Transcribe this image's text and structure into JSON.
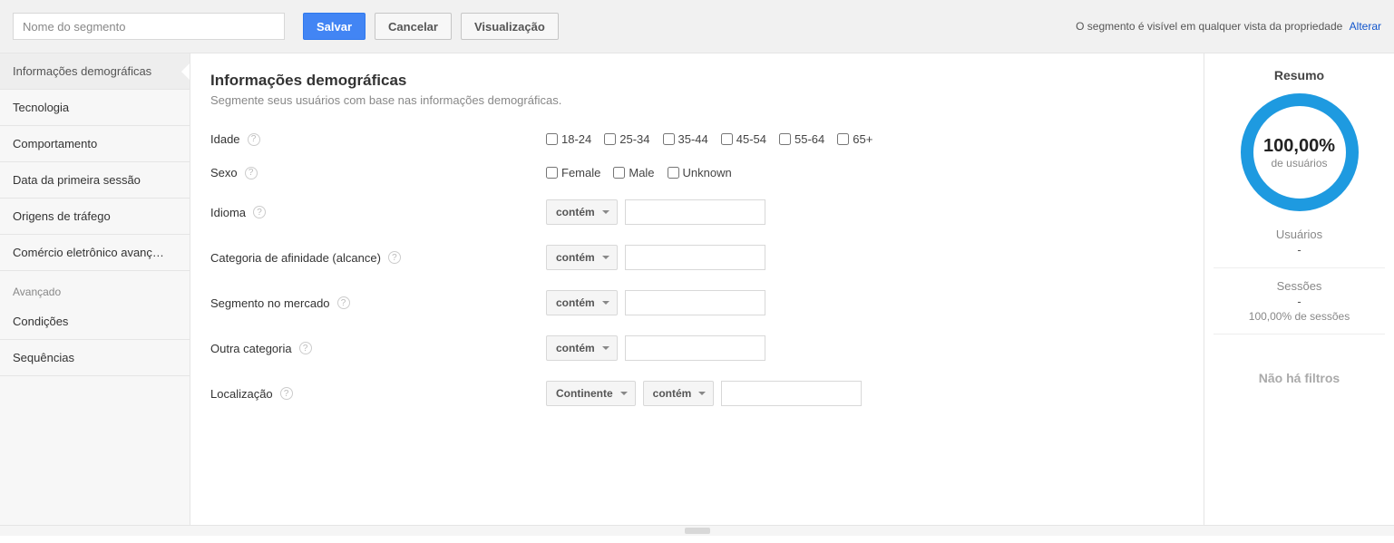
{
  "topbar": {
    "segment_placeholder": "Nome do segmento",
    "save_label": "Salvar",
    "cancel_label": "Cancelar",
    "preview_label": "Visualização",
    "visibility_text": "O segmento é visível em qualquer vista da propriedade",
    "change_link": "Alterar"
  },
  "sidebar": {
    "items": [
      {
        "label": "Informações demográficas",
        "active": true
      },
      {
        "label": "Tecnologia"
      },
      {
        "label": "Comportamento"
      },
      {
        "label": "Data da primeira sessão"
      },
      {
        "label": "Origens de tráfego"
      },
      {
        "label": "Comércio eletrônico avanç…"
      }
    ],
    "advanced_label": "Avançado",
    "advanced_items": [
      {
        "label": "Condições"
      },
      {
        "label": "Sequências"
      }
    ]
  },
  "main": {
    "title": "Informações demográficas",
    "subtitle": "Segmente seus usuários com base nas informações demográficas.",
    "age_label": "Idade",
    "age_options": [
      "18-24",
      "25-34",
      "35-44",
      "45-54",
      "55-64",
      "65+"
    ],
    "gender_label": "Sexo",
    "gender_options": [
      "Female",
      "Male",
      "Unknown"
    ],
    "language_label": "Idioma",
    "affinity_label": "Categoria de afinidade (alcance)",
    "market_label": "Segmento no mercado",
    "other_category_label": "Outra categoria",
    "location_label": "Localização",
    "contains_label": "contém",
    "continent_label": "Continente"
  },
  "summary": {
    "title": "Resumo",
    "donut_value": "100,00%",
    "donut_label": "de usuários",
    "users_label": "Usuários",
    "users_value": "-",
    "sessions_label": "Sessões",
    "sessions_value": "-",
    "sessions_sub": "100,00% de sessões",
    "no_filters": "Não há filtros"
  }
}
